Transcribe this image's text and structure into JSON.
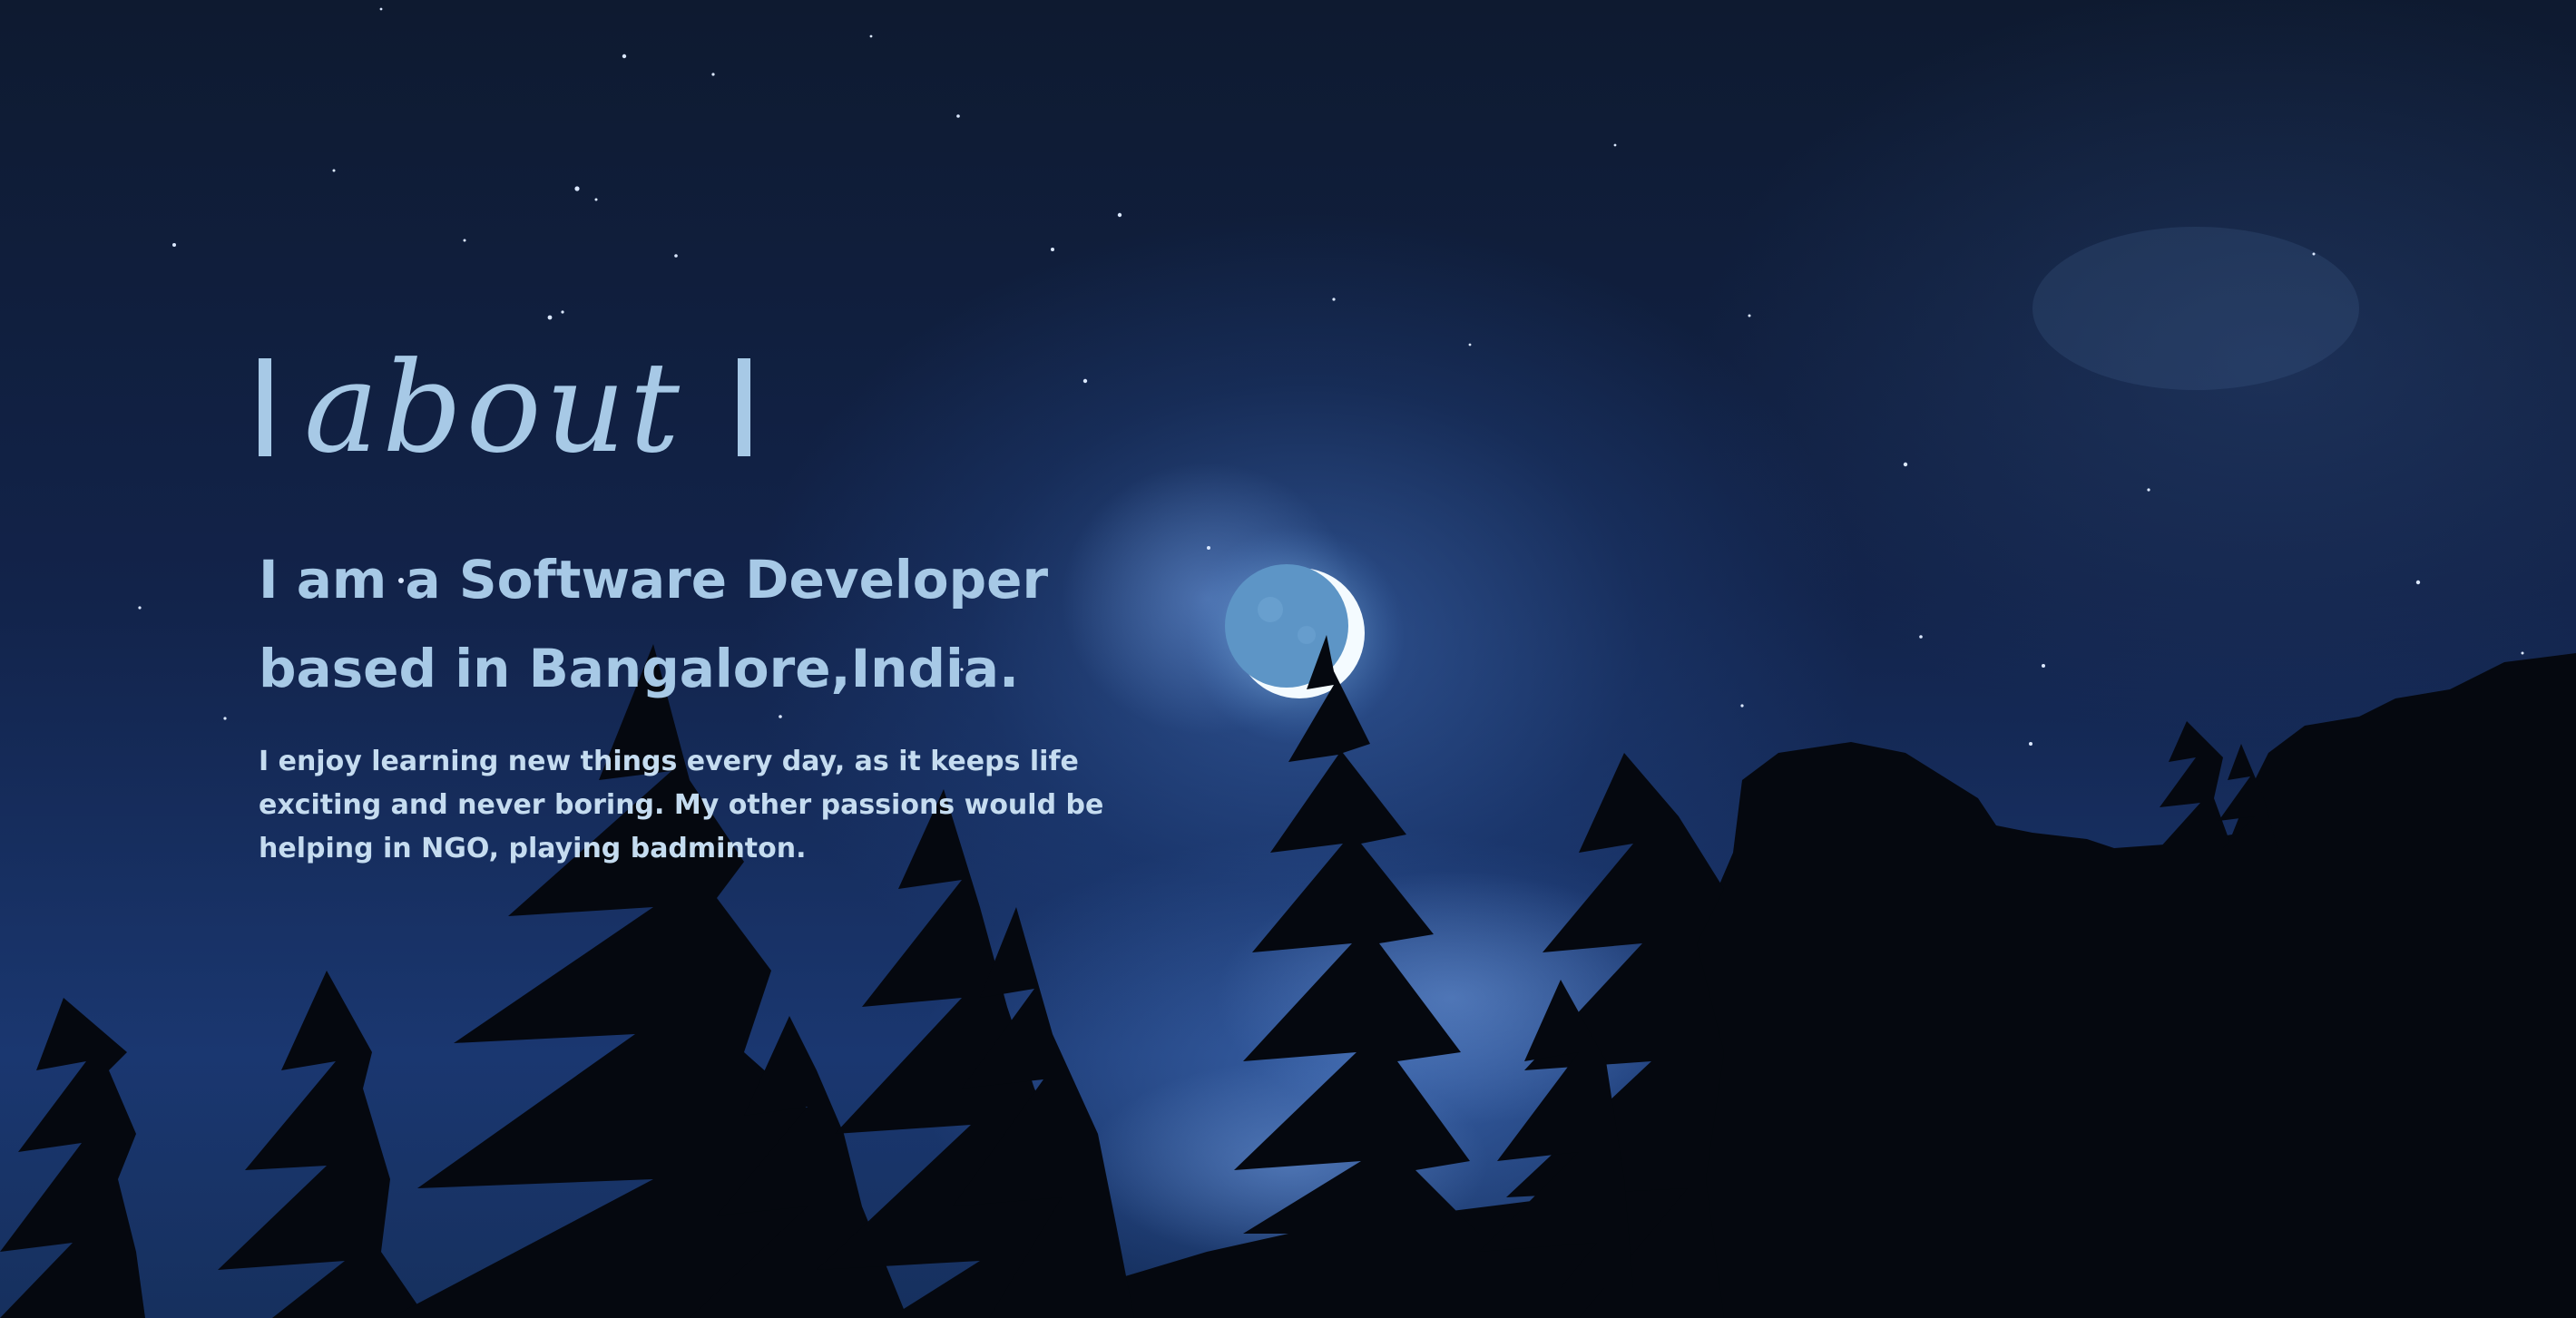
{
  "about": {
    "title": "about",
    "headline": "I am a Software Developer based in Bangalore,India.",
    "bio": "I enjoy learning new things every day, as it keeps life exciting and never boring. My other passions would be helping in NGO, playing badminton."
  },
  "background": {
    "description_icon": "night-sky-moon-forest-image",
    "accent_color": "#a7c9e6",
    "text_color": "#c5dcf0",
    "sky_color": "#12234a"
  }
}
